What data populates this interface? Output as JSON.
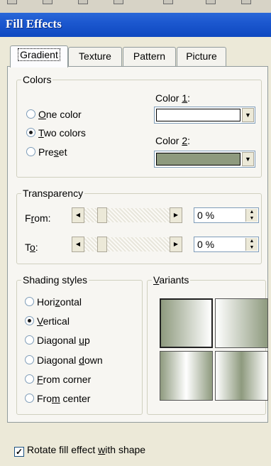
{
  "window": {
    "title": "Fill Effects"
  },
  "tabs": [
    {
      "label": "Gradient",
      "active": true
    },
    {
      "label": "Texture",
      "active": false
    },
    {
      "label": "Pattern",
      "active": false
    },
    {
      "label": "Picture",
      "active": false
    }
  ],
  "colors": {
    "legend": "Colors",
    "options": [
      {
        "label_pre": "",
        "label_acc": "O",
        "label_post": "ne color",
        "selected": false
      },
      {
        "label_pre": "",
        "label_acc": "T",
        "label_post": "wo colors",
        "selected": true
      },
      {
        "label_pre": "Pre",
        "label_acc": "s",
        "label_post": "et",
        "selected": false
      }
    ],
    "color1": {
      "label_pre": "Color ",
      "label_acc": "1",
      "label_post": ":",
      "value": "#ffffff"
    },
    "color2": {
      "label_pre": "Color ",
      "label_acc": "2",
      "label_post": ":",
      "value": "#8e9a7e"
    }
  },
  "transparency": {
    "legend": "Transparency",
    "from": {
      "label_pre": "F",
      "label_acc": "r",
      "label_post": "om:",
      "value": "0 %",
      "level": 0
    },
    "to": {
      "label_pre": "T",
      "label_acc": "o",
      "label_post": ":",
      "value": "0 %",
      "level": 0
    }
  },
  "shading": {
    "legend": "Shading styles",
    "options": [
      {
        "label_pre": "Hori",
        "label_acc": "z",
        "label_post": "ontal",
        "selected": false
      },
      {
        "label_pre": "",
        "label_acc": "V",
        "label_post": "ertical",
        "selected": true
      },
      {
        "label_pre": "Diagonal ",
        "label_acc": "u",
        "label_post": "p",
        "selected": false
      },
      {
        "label_pre": "Diagonal ",
        "label_acc": "d",
        "label_post": "own",
        "selected": false
      },
      {
        "label_pre": "",
        "label_acc": "F",
        "label_post": "rom corner",
        "selected": false
      },
      {
        "label_pre": "Fro",
        "label_acc": "m",
        "label_post": " center",
        "selected": false
      }
    ]
  },
  "variants": {
    "legend_pre": "",
    "legend_acc": "V",
    "legend_post": "ariants",
    "selected_index": 0
  },
  "rotate": {
    "label_pre": "Rotate fill effect ",
    "label_acc": "w",
    "label_post": "ith shape",
    "checked": true,
    "check_glyph": "✓"
  },
  "icons": {
    "radio": "radio-button-icon",
    "dropdown": "chevron-down-icon",
    "scroll_left": "arrow-left-icon",
    "scroll_right": "arrow-right-icon",
    "spin": "spin-arrows-icon"
  }
}
